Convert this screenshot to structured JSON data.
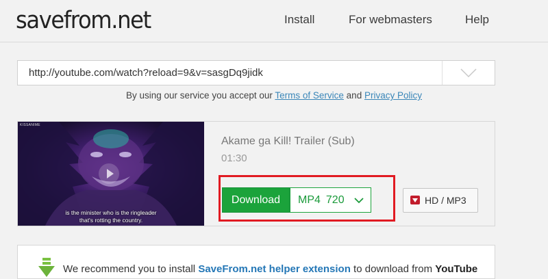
{
  "header": {
    "logo": "savefrom.net",
    "nav": [
      "Install",
      "For webmasters",
      "Help"
    ]
  },
  "search": {
    "url_value": "http://youtube.com/watch?reload=9&v=sasgDq9jidk",
    "terms_prefix": "By using our service you accept our ",
    "terms_link": "Terms of Service",
    "terms_and": " and ",
    "privacy_link": "Privacy Policy"
  },
  "result": {
    "thumb_label": "KISSANIME",
    "subtitle_line1": "is the minister who is the ringleader",
    "subtitle_line2": "that's rotting the country.",
    "title": "Akame ga Kill! Trailer (Sub)",
    "duration": "01:30",
    "download_label": "Download",
    "format": "MP4",
    "quality": "720",
    "hd_label": "HD / MP3"
  },
  "recommend": {
    "prefix": "We recommend you to install ",
    "link": "SaveFrom.net helper extension",
    "middle": " to download from ",
    "site": "YouTube"
  },
  "colors": {
    "accent_green": "#1ba33b",
    "highlight_red": "#e11a22",
    "link_blue": "#3a86b8"
  },
  "icons": [
    "chevron-down-icon",
    "play-icon",
    "download-icon",
    "green-arrow-icon"
  ]
}
